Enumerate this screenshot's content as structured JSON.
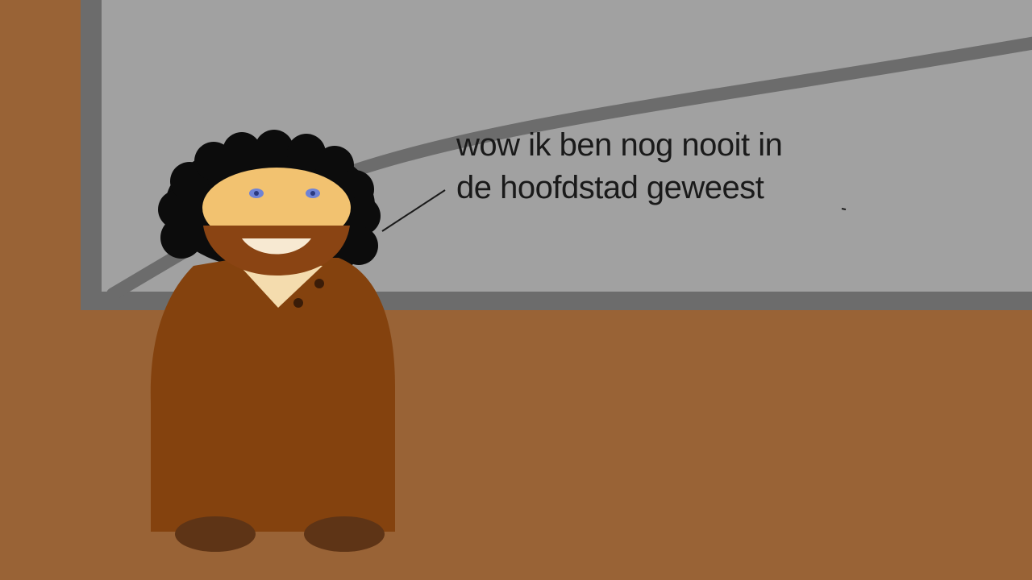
{
  "speech": {
    "line1": "wow ik ben nog nooit in",
    "line2": "de hoofdstad geweest"
  },
  "colors": {
    "wall": "#996336",
    "window_glass": "#a1a1a1",
    "window_frame": "#6c6c6c",
    "coat": "#84420e",
    "skin": "#f2c270",
    "beard": "#8a4413",
    "hair": "#0c0c0c",
    "eyes": "#6f83d6",
    "shoes": "#5e3416",
    "collar": "#f4dcae"
  }
}
